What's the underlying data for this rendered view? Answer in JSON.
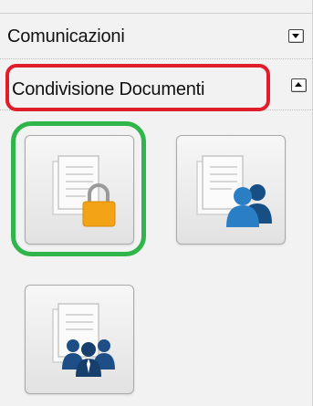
{
  "panel": {
    "sections": [
      {
        "label": "Comunicazioni",
        "state": "collapsed",
        "toggle_icon": "chevron-down-icon"
      },
      {
        "label": "Condivisione Documenti",
        "state": "expanded",
        "toggle_icon": "chevron-up-icon"
      }
    ],
    "tiles": [
      {
        "icon": "document-lock-icon"
      },
      {
        "icon": "document-users-icon"
      },
      {
        "icon": "document-group-icon"
      }
    ]
  },
  "annotations": {
    "highlight_colors": {
      "section_header": "#e01e2b",
      "selected_tile": "#2fb54a"
    }
  },
  "colors": {
    "lock": "#f3a316",
    "users": "#1e6fb0",
    "group": "#1d4f86",
    "document": "#c9c9c9"
  }
}
